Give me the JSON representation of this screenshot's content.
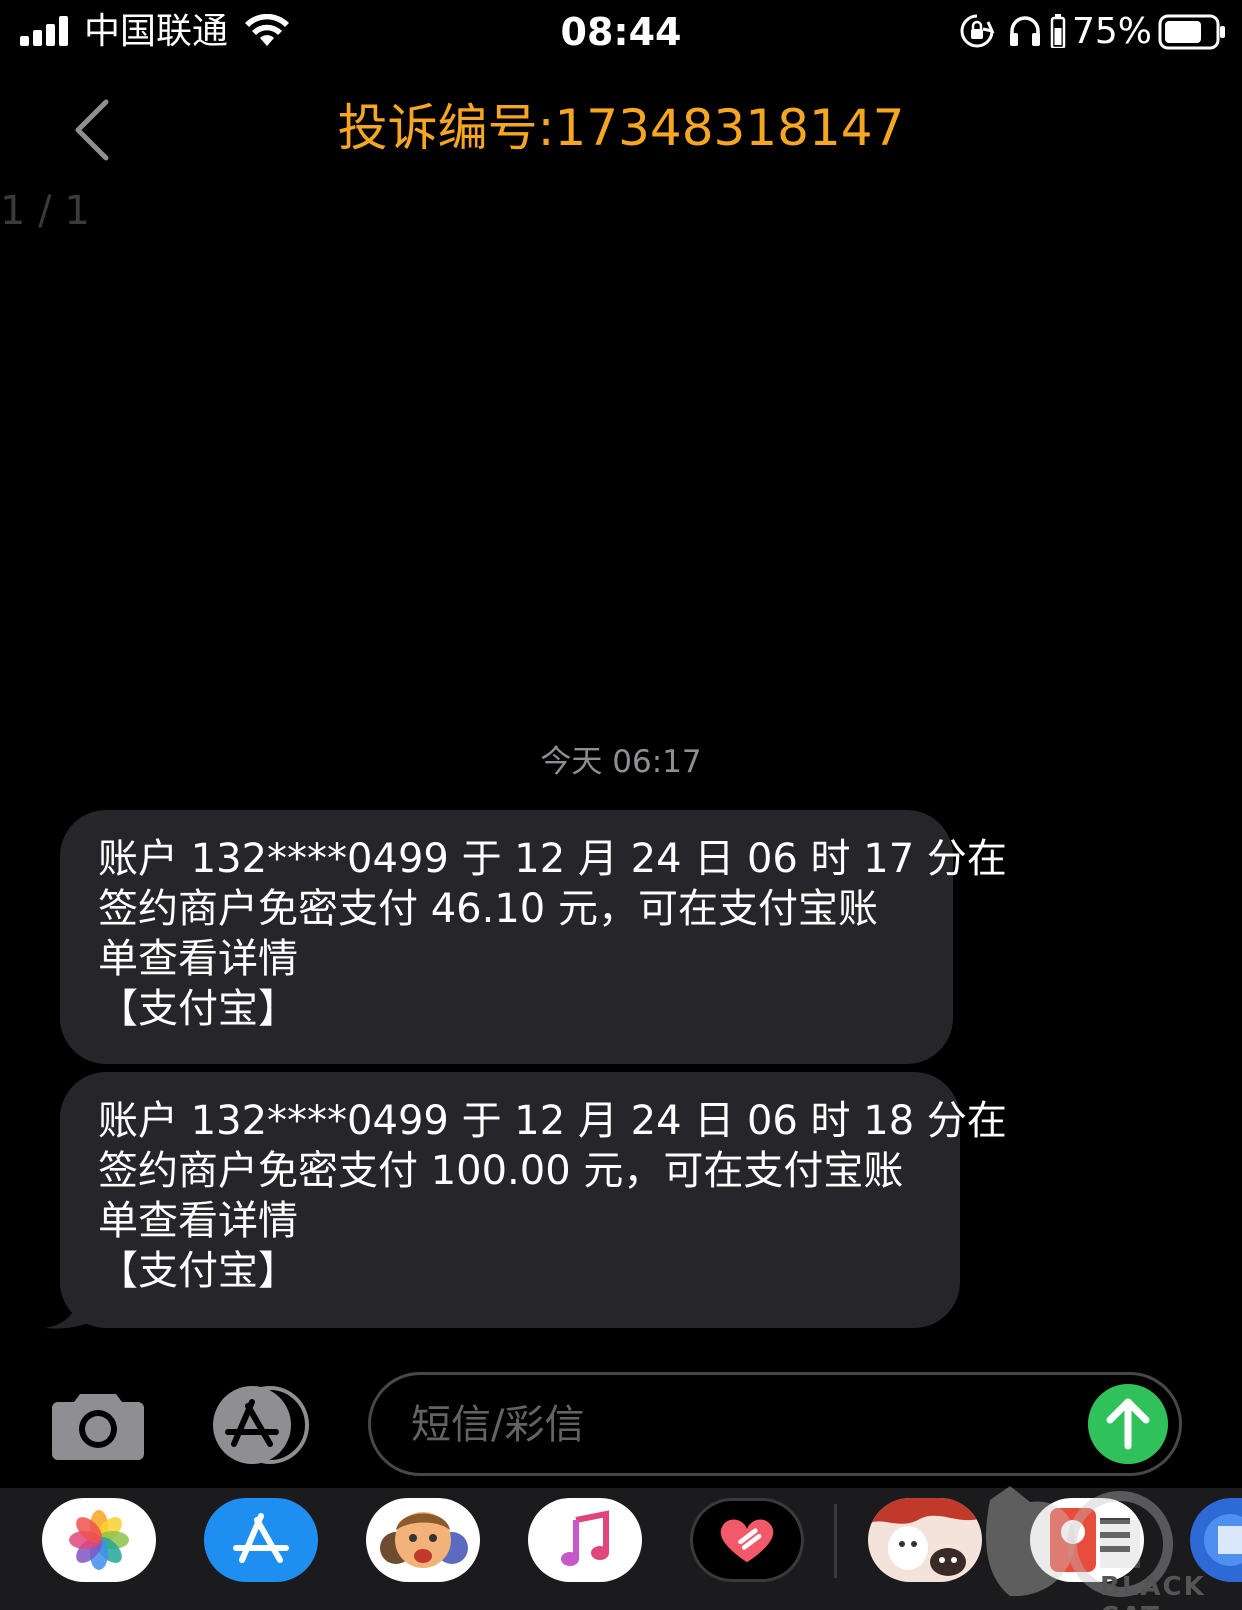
{
  "status_bar": {
    "carrier": "中国联通",
    "time": "08:44",
    "battery_percent": "75%",
    "battery_level": 0.75,
    "icons": [
      "signal-icon",
      "wifi-icon",
      "rotation-lock-icon",
      "headphones-icon",
      "battery-icon"
    ]
  },
  "nav": {
    "title": "投诉编号:17348318147",
    "back_icon": "chevron-left-icon",
    "title_color": "#f5a623",
    "pager": "1 / 1"
  },
  "thread": {
    "timestamp": "今天 06:17",
    "messages": [
      {
        "lines": [
          "账户 132****0499 于 12 月 24 日 06 时 17 分在",
          "签约商户免密支付 46.10 元，可在支付宝账",
          "单查看详情",
          "【支付宝】"
        ]
      },
      {
        "lines": [
          "账户 132****0499 于 12 月 24 日 06 时 18 分在",
          "签约商户免密支付 100.00 元，可在支付宝账",
          "单查看详情",
          "【支付宝】"
        ]
      }
    ]
  },
  "composer": {
    "placeholder": "短信/彩信",
    "camera_icon": "camera-icon",
    "apps_icon": "app-store-icon",
    "send_icon": "arrow-up-icon",
    "send_color": "#30c15a"
  },
  "dock": {
    "apps": [
      "photos-icon",
      "app-store-icon",
      "memoji-icon",
      "music-icon",
      "digital-touch-icon",
      "sticker-icon",
      "app-icon"
    ]
  },
  "watermark": {
    "text": "BLACK CAT"
  }
}
